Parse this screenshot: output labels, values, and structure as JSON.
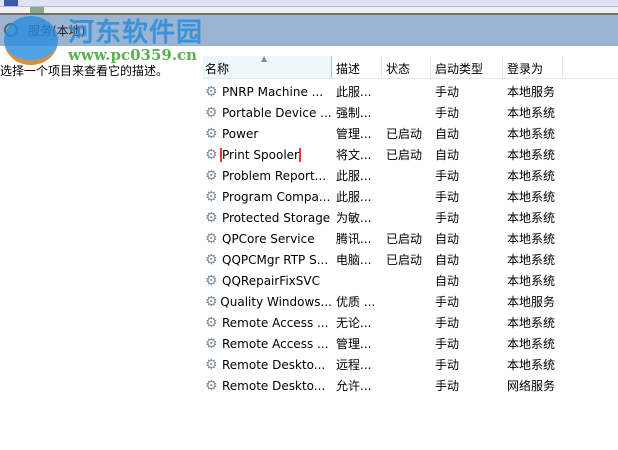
{
  "header": {
    "title": "服务(本地)"
  },
  "left_pane": {
    "description": "选择一个项目来查看它的描述。"
  },
  "watermark": {
    "name": "河东软件园",
    "url": "www.pc0359.cn"
  },
  "columns": [
    "名称",
    "描述",
    "状态",
    "启动类型",
    "登录为"
  ],
  "selected_row": "Print Spooler",
  "rows": [
    {
      "name": "PNRP Machine ...",
      "desc": "此服...",
      "status": "",
      "startup": "手动",
      "logon": "本地服务"
    },
    {
      "name": "Portable Device ...",
      "desc": "强制...",
      "status": "",
      "startup": "手动",
      "logon": "本地系统"
    },
    {
      "name": "Power",
      "desc": "管理...",
      "status": "已启动",
      "startup": "自动",
      "logon": "本地系统"
    },
    {
      "name": "Print Spooler",
      "desc": "将文...",
      "status": "已启动",
      "startup": "自动",
      "logon": "本地系统"
    },
    {
      "name": "Problem Report...",
      "desc": "此服...",
      "status": "",
      "startup": "手动",
      "logon": "本地系统"
    },
    {
      "name": "Program Compa...",
      "desc": "此服...",
      "status": "",
      "startup": "手动",
      "logon": "本地系统"
    },
    {
      "name": "Protected Storage",
      "desc": "为敏...",
      "status": "",
      "startup": "手动",
      "logon": "本地系统"
    },
    {
      "name": "QPCore Service",
      "desc": "腾讯...",
      "status": "已启动",
      "startup": "自动",
      "logon": "本地系统"
    },
    {
      "name": "QQPCMgr RTP S...",
      "desc": "电脑...",
      "status": "已启动",
      "startup": "自动",
      "logon": "本地系统"
    },
    {
      "name": "QQRepairFixSVC",
      "desc": "",
      "status": "",
      "startup": "自动",
      "logon": "本地系统"
    },
    {
      "name": "Quality Windows...",
      "desc": "优质 ...",
      "status": "",
      "startup": "手动",
      "logon": "本地服务"
    },
    {
      "name": "Remote Access ...",
      "desc": "无论...",
      "status": "",
      "startup": "手动",
      "logon": "本地系统"
    },
    {
      "name": "Remote Access ...",
      "desc": "管理...",
      "status": "",
      "startup": "手动",
      "logon": "本地系统"
    },
    {
      "name": "Remote Deskto...",
      "desc": "远程...",
      "status": "",
      "startup": "手动",
      "logon": "本地系统"
    },
    {
      "name": "Remote Deskto...",
      "desc": "允许...",
      "status": "",
      "startup": "手动",
      "logon": "网络服务"
    }
  ]
}
